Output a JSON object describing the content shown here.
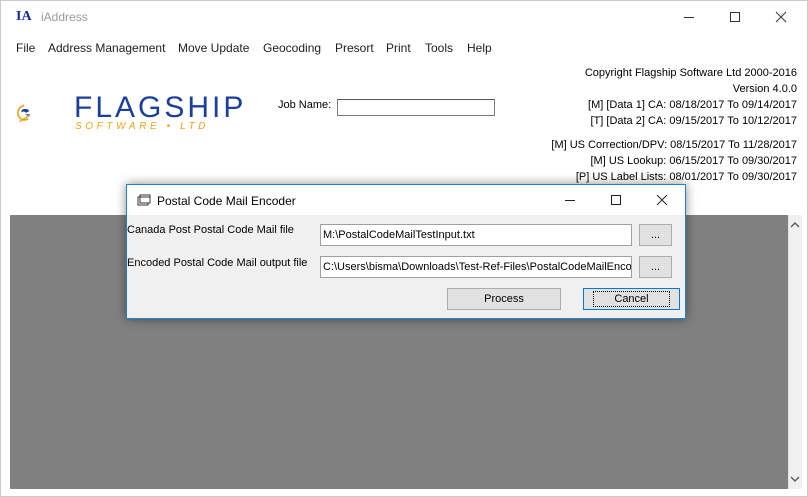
{
  "app": {
    "icon_text": "IA",
    "title": "iAddress"
  },
  "menu": [
    "File",
    "Address Management",
    "Move Update",
    "Geocoding",
    "Presort",
    "Print",
    "Tools",
    "Help"
  ],
  "logo": {
    "name": "FLAGSHIP",
    "sub": "SOFTWARE • LTD",
    "brand_blue": "#1b3f9c",
    "brand_orange": "#f0a21b"
  },
  "job": {
    "label": "Job Name:",
    "value": ""
  },
  "info": {
    "copyright": "Copyright Flagship Software Ltd 2000-2016",
    "version": "Version 4.0.0",
    "data1": "[M] [Data 1] CA: 08/18/2017 To 09/14/2017",
    "data2": "[T] [Data 2] CA: 09/15/2017 To 10/12/2017",
    "us_correction": "[M] US Correction/DPV: 08/15/2017 To 11/28/2017",
    "us_lookup": "[M] US Lookup: 06/15/2017 To 09/30/2017",
    "us_label": "[P] US Label Lists: 08/01/2017 To 09/30/2017"
  },
  "dialog": {
    "title": "Postal Code Mail Encoder",
    "input_label": "Canada Post Postal Code Mail file",
    "input_value": "M:\\PostalCodeMailTestInput.txt",
    "output_label": "Encoded Postal Code Mail output file",
    "output_value": "C:\\Users\\bisma\\Downloads\\Test-Ref-Files\\PostalCodeMailEncoded",
    "browse_label": "...",
    "process_label": "Process",
    "cancel_label": "Cancel"
  }
}
